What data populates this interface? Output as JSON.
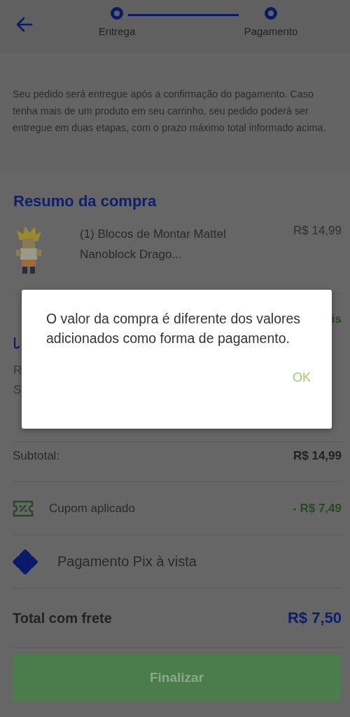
{
  "header": {
    "steps": [
      {
        "label": "Entrega"
      },
      {
        "label": "Pagamento"
      }
    ]
  },
  "notice": "Seu pedido será entregue após a confirmação do pagamento. Caso tenha mais de um produto em seu carrinho, seu pedido poderá ser entregue em duas etapas, com o prazo máximo total informado acima.",
  "summary": {
    "title": "Resumo da compra",
    "items": [
      {
        "name": "(1) Blocos de Montar Mattel Nanoblock Drago...",
        "price": "R$ 14,99"
      }
    ]
  },
  "covered": {
    "right_text": "is",
    "left_lines": [
      "R",
      "S"
    ]
  },
  "totals": [
    {
      "kind": "plain",
      "label": "Subtotal:",
      "value": "R$ 14,99"
    },
    {
      "kind": "coupon",
      "label": "Cupom aplicado",
      "value": "- R$ 7,49"
    },
    {
      "kind": "payment",
      "label": "Pagamento Pix à vista"
    },
    {
      "kind": "total",
      "label": "Total com frete",
      "value": "R$ 7,50"
    }
  ],
  "finish_button": "Finalizar",
  "dialog": {
    "message": "O valor da compra é diferente dos valores adicionados como forma de pagamento.",
    "button": "OK"
  }
}
